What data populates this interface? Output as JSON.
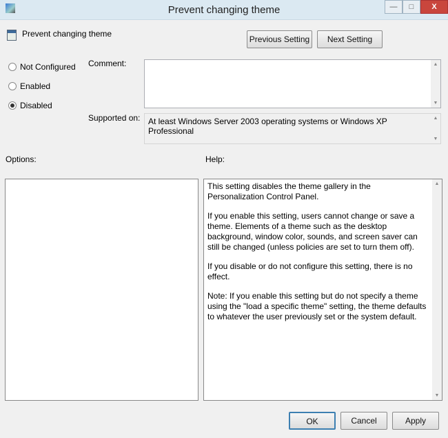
{
  "window": {
    "title": "Prevent changing theme",
    "minimize": "—",
    "maximize": "□",
    "close": "X"
  },
  "header": {
    "policy_name": "Prevent changing theme",
    "prev_button": "Previous Setting",
    "next_button": "Next Setting"
  },
  "state": {
    "options": [
      {
        "label": "Not Configured",
        "selected": false
      },
      {
        "label": "Enabled",
        "selected": false
      },
      {
        "label": "Disabled",
        "selected": true
      }
    ]
  },
  "comment": {
    "label": "Comment:",
    "value": ""
  },
  "supported": {
    "label": "Supported on:",
    "value": "At least Windows Server 2003 operating systems or Windows XP Professional"
  },
  "options_label": "Options:",
  "help_label": "Help:",
  "help_text": [
    "This setting disables the theme gallery in the Personalization Control Panel.",
    "If you enable this setting, users cannot change or save a theme. Elements of a theme such as the desktop background, window color, sounds, and screen saver can still be changed (unless policies are set to turn them off).",
    "If you disable or do not configure this setting, there is no effect.",
    "Note: If you enable this setting but do not specify a theme using the \"load a specific theme\" setting, the theme defaults to whatever the user previously set or the system default."
  ],
  "footer": {
    "ok": "OK",
    "cancel": "Cancel",
    "apply": "Apply"
  }
}
